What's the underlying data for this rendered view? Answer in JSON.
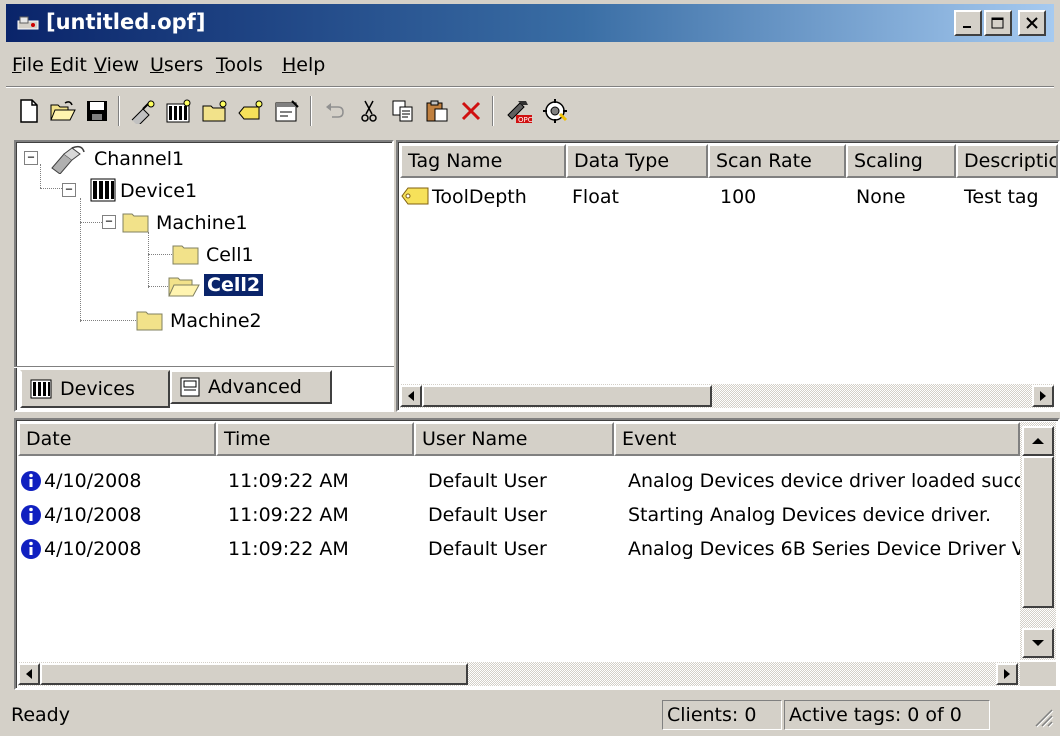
{
  "window": {
    "title": "[untitled.opf]"
  },
  "menu": [
    {
      "label": "File",
      "key": "F"
    },
    {
      "label": "Edit",
      "key": "E"
    },
    {
      "label": "View",
      "key": "V"
    },
    {
      "label": "Users",
      "key": "U"
    },
    {
      "label": "Tools",
      "key": "T"
    },
    {
      "label": "Help",
      "key": "H"
    }
  ],
  "toolbar": {
    "icons": [
      "new-icon",
      "open-icon",
      "save-icon",
      "new-channel-icon",
      "new-device-icon",
      "new-group-icon",
      "new-tag-icon",
      "properties-icon",
      "undo-icon",
      "cut-icon",
      "copy-icon",
      "paste-icon",
      "delete-icon",
      "opc-quick-client-icon",
      "runtime-connect-icon"
    ]
  },
  "tree": {
    "channel": "Channel1",
    "device": "Device1",
    "machine1": "Machine1",
    "cell1": "Cell1",
    "cell2": "Cell2",
    "machine2": "Machine2",
    "selected": "Cell2"
  },
  "tabs": {
    "devices": "Devices",
    "advanced": "Advanced"
  },
  "tags_table": {
    "columns": [
      "Tag Name",
      "Data Type",
      "Scan Rate",
      "Scaling",
      "Descriptic"
    ],
    "rows": [
      {
        "name": "ToolDepth",
        "type": "Float",
        "rate": "100",
        "scaling": "None",
        "description": "Test tag"
      }
    ]
  },
  "log": {
    "columns": [
      "Date",
      "Time",
      "User Name",
      "Event"
    ],
    "rows": [
      {
        "date": "4/10/2008",
        "time": "11:09:22 AM",
        "user": "Default User",
        "event": "Analog Devices device driver loaded succ"
      },
      {
        "date": "4/10/2008",
        "time": "11:09:22 AM",
        "user": "Default User",
        "event": "Starting Analog Devices device driver."
      },
      {
        "date": "4/10/2008",
        "time": "11:09:22 AM",
        "user": "Default User",
        "event": "Analog Devices 6B Series Device Driver V"
      }
    ]
  },
  "status": {
    "text": "Ready",
    "clients": "Clients:  0",
    "active_tags": "Active tags:  0 of 0"
  },
  "colors": {
    "title_start": "#0a246a",
    "title_end": "#a6caf0",
    "face": "#d4d0c8",
    "selection": "#0a246a",
    "info": "#1020c0",
    "folder": "#f2e28a"
  }
}
